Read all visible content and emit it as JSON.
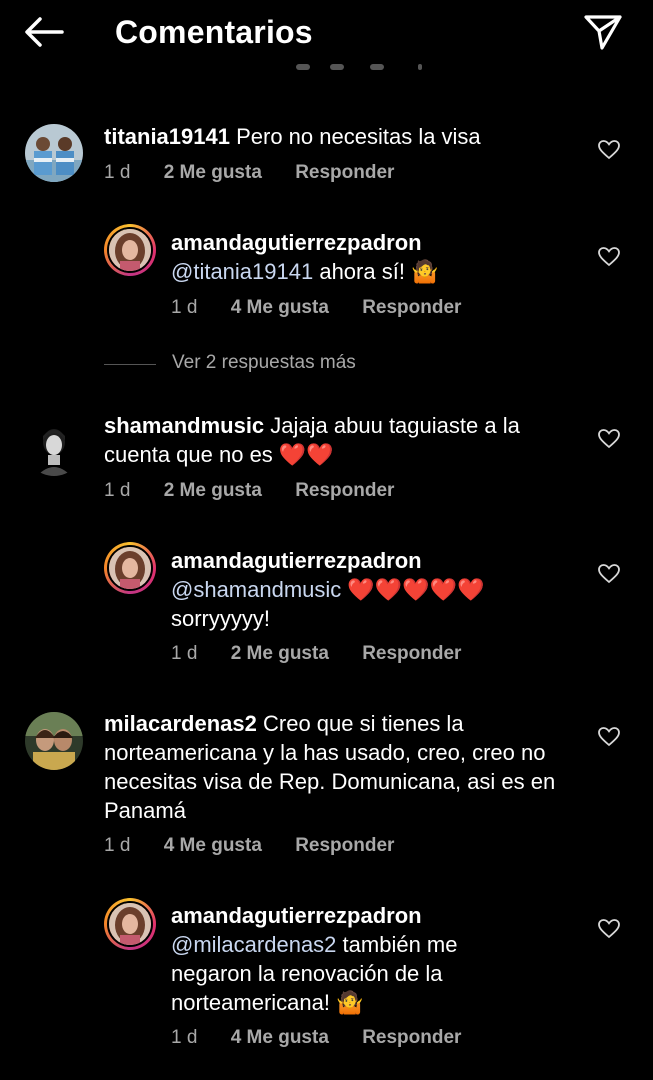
{
  "header": {
    "title": "Comentarios",
    "back_icon": "arrow-left-icon",
    "share_icon": "paper-plane-icon"
  },
  "comments": [
    {
      "username": "titania19141",
      "text": "Pero no necesitas la visa",
      "age": "1 d",
      "likes": "2 Me gusta",
      "reply": "Responder"
    },
    {
      "username": "amandagutierrezpadron",
      "mention": "@titania19141",
      "text": " ahora sí! 🤷",
      "age": "1 d",
      "likes": "4 Me gusta",
      "reply": "Responder"
    },
    {
      "username": "shamandmusic",
      "text": "Jajaja abuu taguiaste a la cuenta que no es ❤️❤️",
      "age": "1 d",
      "likes": "2 Me gusta",
      "reply": "Responder"
    },
    {
      "username": "amandagutierrezpadron",
      "mention": "@shamandmusic",
      "text": " ❤️❤️❤️❤️❤️ sorryyyyy!",
      "age": "1 d",
      "likes": "2 Me gusta",
      "reply": "Responder"
    },
    {
      "username": "milacardenas2",
      "text": "Creo que si tienes la norteamericana y la has usado, creo, creo no necesitas visa de Rep. Domunicana, asi es en Panamá",
      "age": "1 d",
      "likes": "4 Me gusta",
      "reply": "Responder"
    },
    {
      "username": "amandagutierrezpadron",
      "mention": "@milacardenas2",
      "text": "  también me negaron la renovación de la norteamericana! 🤷",
      "age": "1 d",
      "likes": "4 Me gusta",
      "reply": "Responder"
    }
  ],
  "more_replies": "Ver 2 respuestas más"
}
